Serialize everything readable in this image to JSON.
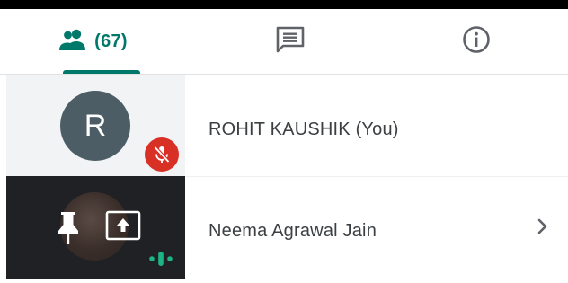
{
  "tabs": {
    "people": {
      "icon": "people-icon",
      "count_label": "(67)"
    },
    "chat": {
      "icon": "chat-icon"
    },
    "info": {
      "icon": "info-icon"
    },
    "active": "people"
  },
  "participants": [
    {
      "name": "ROHIT KAUSHIK (You)",
      "avatar_initial": "R",
      "avatar_color": "#4d5d66",
      "status_icon": "mic-off-icon",
      "status_color": "#d93025"
    },
    {
      "name": "Neema Agrawal Jain",
      "tile_icons": [
        "pin-icon",
        "present-to-all-icon",
        "speaking-indicator-icon"
      ],
      "action_icon": "chevron-right-icon",
      "speaking_color": "#1db386"
    }
  ],
  "colors": {
    "accent": "#00796b",
    "tab_icon": "#5f6368"
  }
}
